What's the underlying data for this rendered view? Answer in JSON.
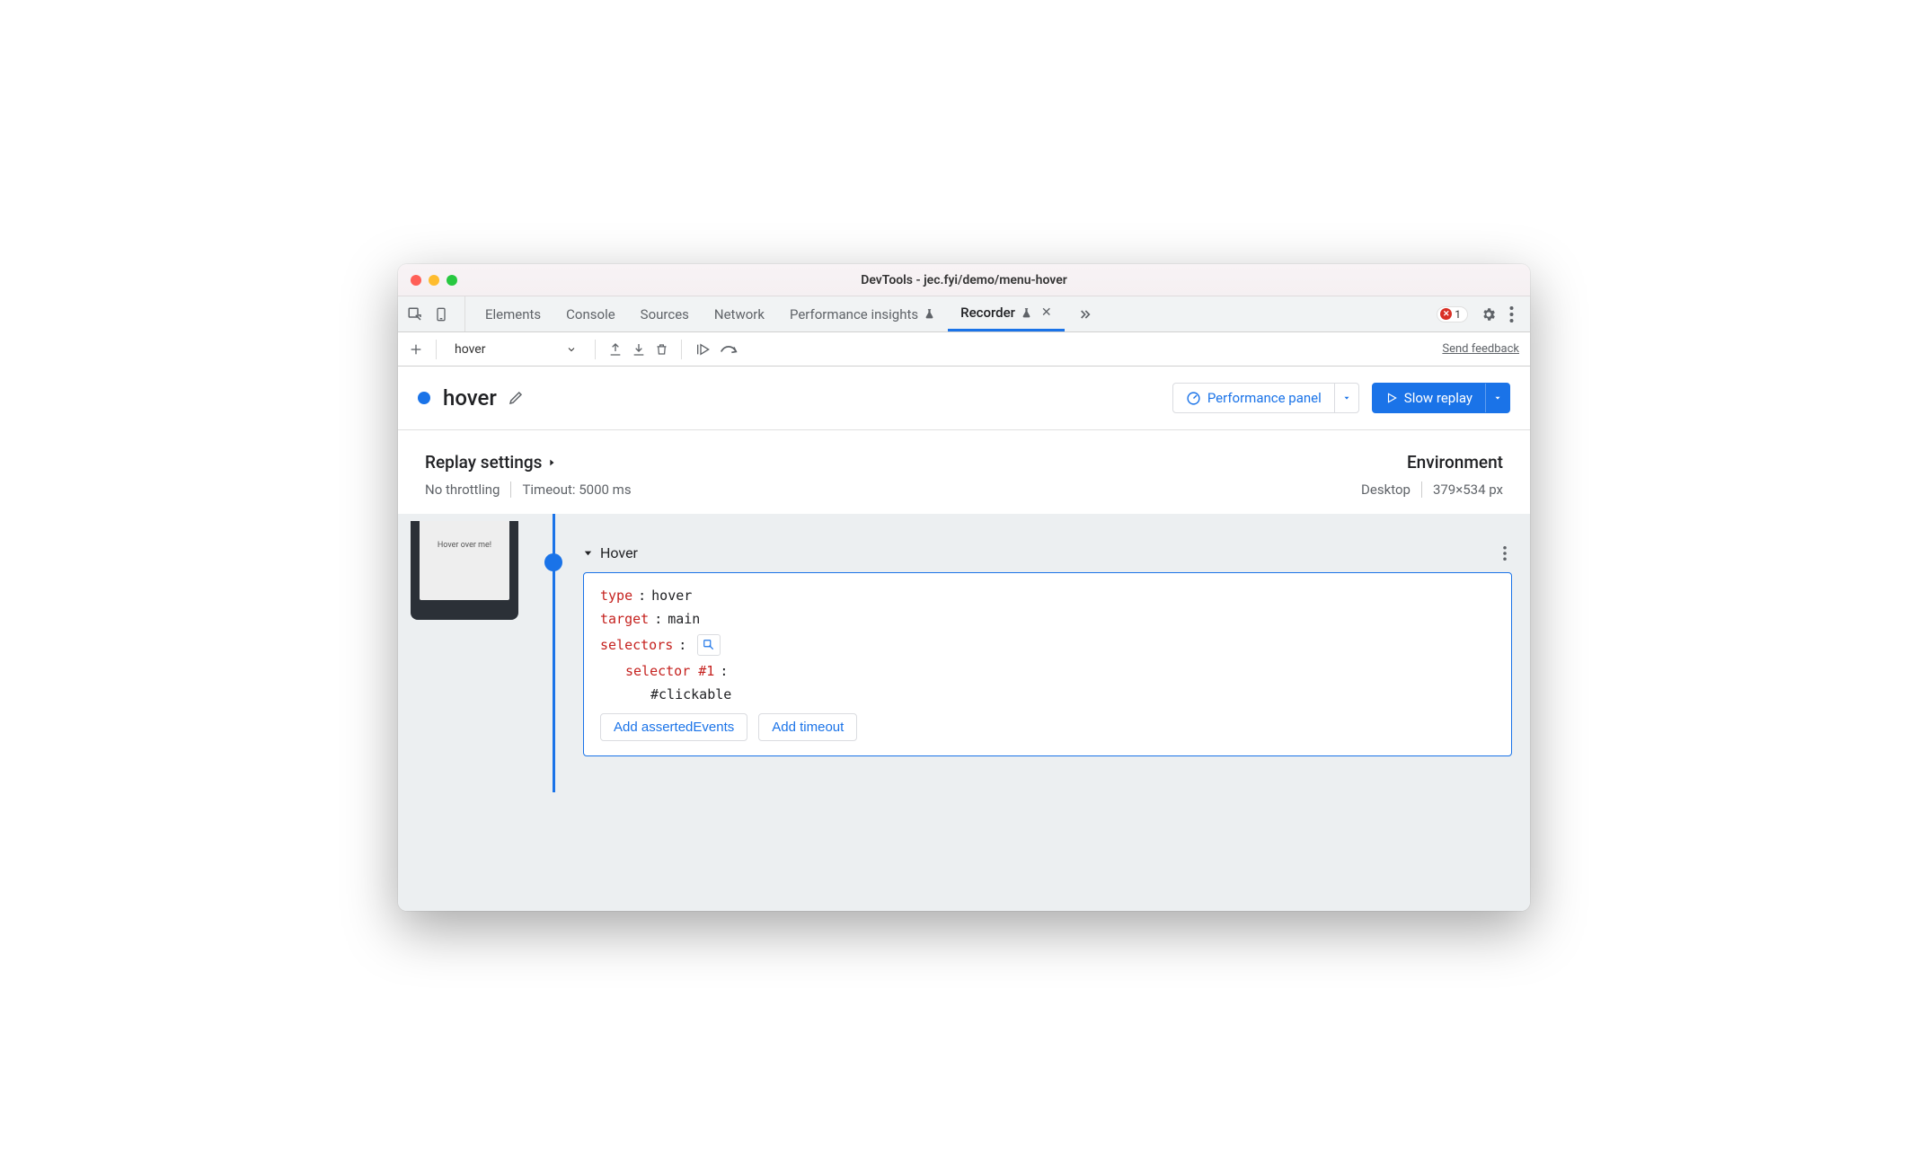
{
  "window": {
    "title": "DevTools - jec.fyi/demo/menu-hover"
  },
  "tabs": {
    "items": [
      "Elements",
      "Console",
      "Sources",
      "Network",
      "Performance insights",
      "Recorder"
    ],
    "active": "Recorder",
    "error_count": "1"
  },
  "toolbar": {
    "recording_select": "hover",
    "feedback": "Send feedback"
  },
  "recording": {
    "name": "hover",
    "perf_button": "Performance panel",
    "replay_button": "Slow replay"
  },
  "settings": {
    "replay_title": "Replay settings",
    "throttling": "No throttling",
    "timeout": "Timeout: 5000 ms",
    "env_title": "Environment",
    "device": "Desktop",
    "viewport": "379×534 px"
  },
  "thumbnail": {
    "caption": "Hover over me!"
  },
  "step": {
    "title": "Hover",
    "props": {
      "type_key": "type",
      "type_val": "hover",
      "target_key": "target",
      "target_val": "main",
      "selectors_key": "selectors",
      "selector_label": "selector #1",
      "selector_val": "#clickable"
    },
    "actions": {
      "asserted": "Add assertedEvents",
      "timeout": "Add timeout"
    }
  }
}
